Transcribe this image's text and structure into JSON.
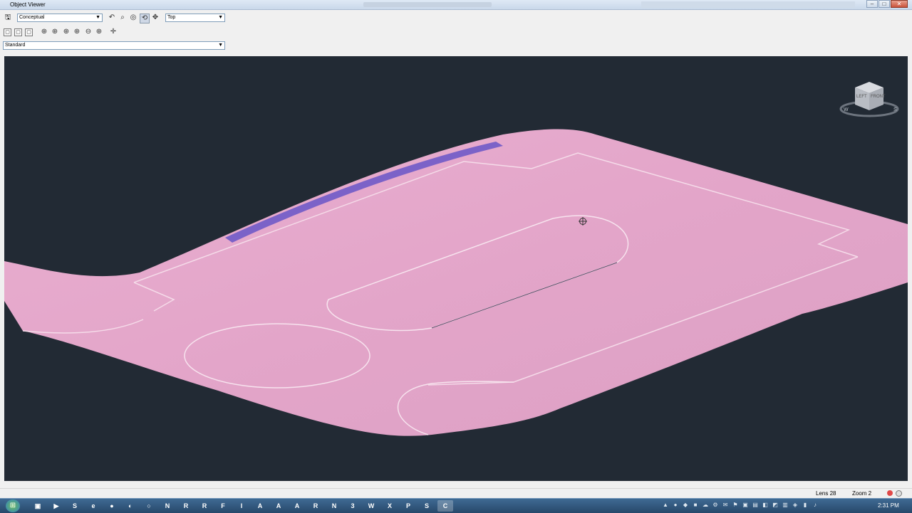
{
  "window": {
    "title": "Object Viewer",
    "controls": {
      "minimize": "–",
      "maximize": "□",
      "close": "✕"
    }
  },
  "toolbar": {
    "visual_style": "Conceptual",
    "view": "Top",
    "icons_row1": [
      "save-icon",
      "undo-view-icon",
      "zoom-icon",
      "orbit-icon",
      "orbit-pressed-icon",
      "pan-icon"
    ],
    "icons_row2": [
      "view-cube-icon",
      "view-cube-2-icon",
      "view-cube-3-icon",
      "zoom-realtime-icon",
      "zoom-window-icon",
      "zoom-center-icon",
      "zoom-in-icon",
      "zoom-out-icon",
      "zoom-extents-icon",
      "steering-wheel-icon"
    ]
  },
  "named_view": "Standard",
  "viewcube": {
    "face_left": "LEFT",
    "face_front": "FRONT",
    "compass_w": "W",
    "compass_s": "S"
  },
  "status": {
    "lens": "Lens 28",
    "zoom": "Zoom 2"
  },
  "taskbar": {
    "apps": [
      "▣",
      "▶",
      "S",
      "e",
      "●",
      "◐",
      "○",
      "N",
      "R",
      "R",
      "F",
      "I",
      "A",
      "A",
      "A",
      "R",
      "N",
      "3",
      "W",
      "X",
      "P",
      "S",
      "C"
    ],
    "active_app_index": 22,
    "clock": "2:31 PM"
  },
  "colors": {
    "surface": "#e4a6c9",
    "viewport_bg": "#222a34",
    "edge": "#7b62c8"
  }
}
